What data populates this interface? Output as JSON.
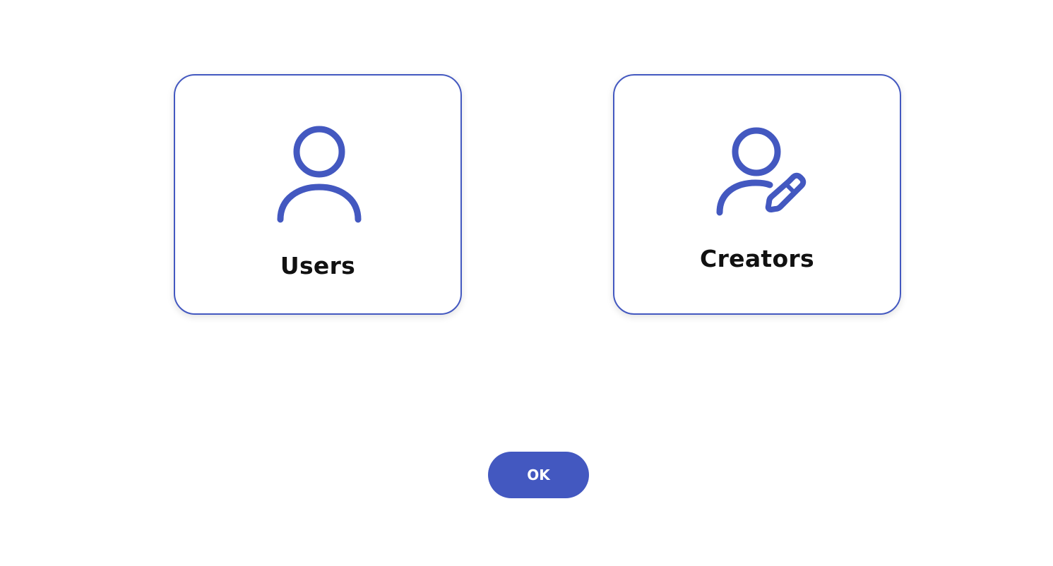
{
  "accent_color": "#4358c0",
  "options": [
    {
      "label": "Users",
      "icon": "user-icon"
    },
    {
      "label": "Creators",
      "icon": "user-edit-icon"
    }
  ],
  "ok_button": {
    "label": "OK"
  }
}
